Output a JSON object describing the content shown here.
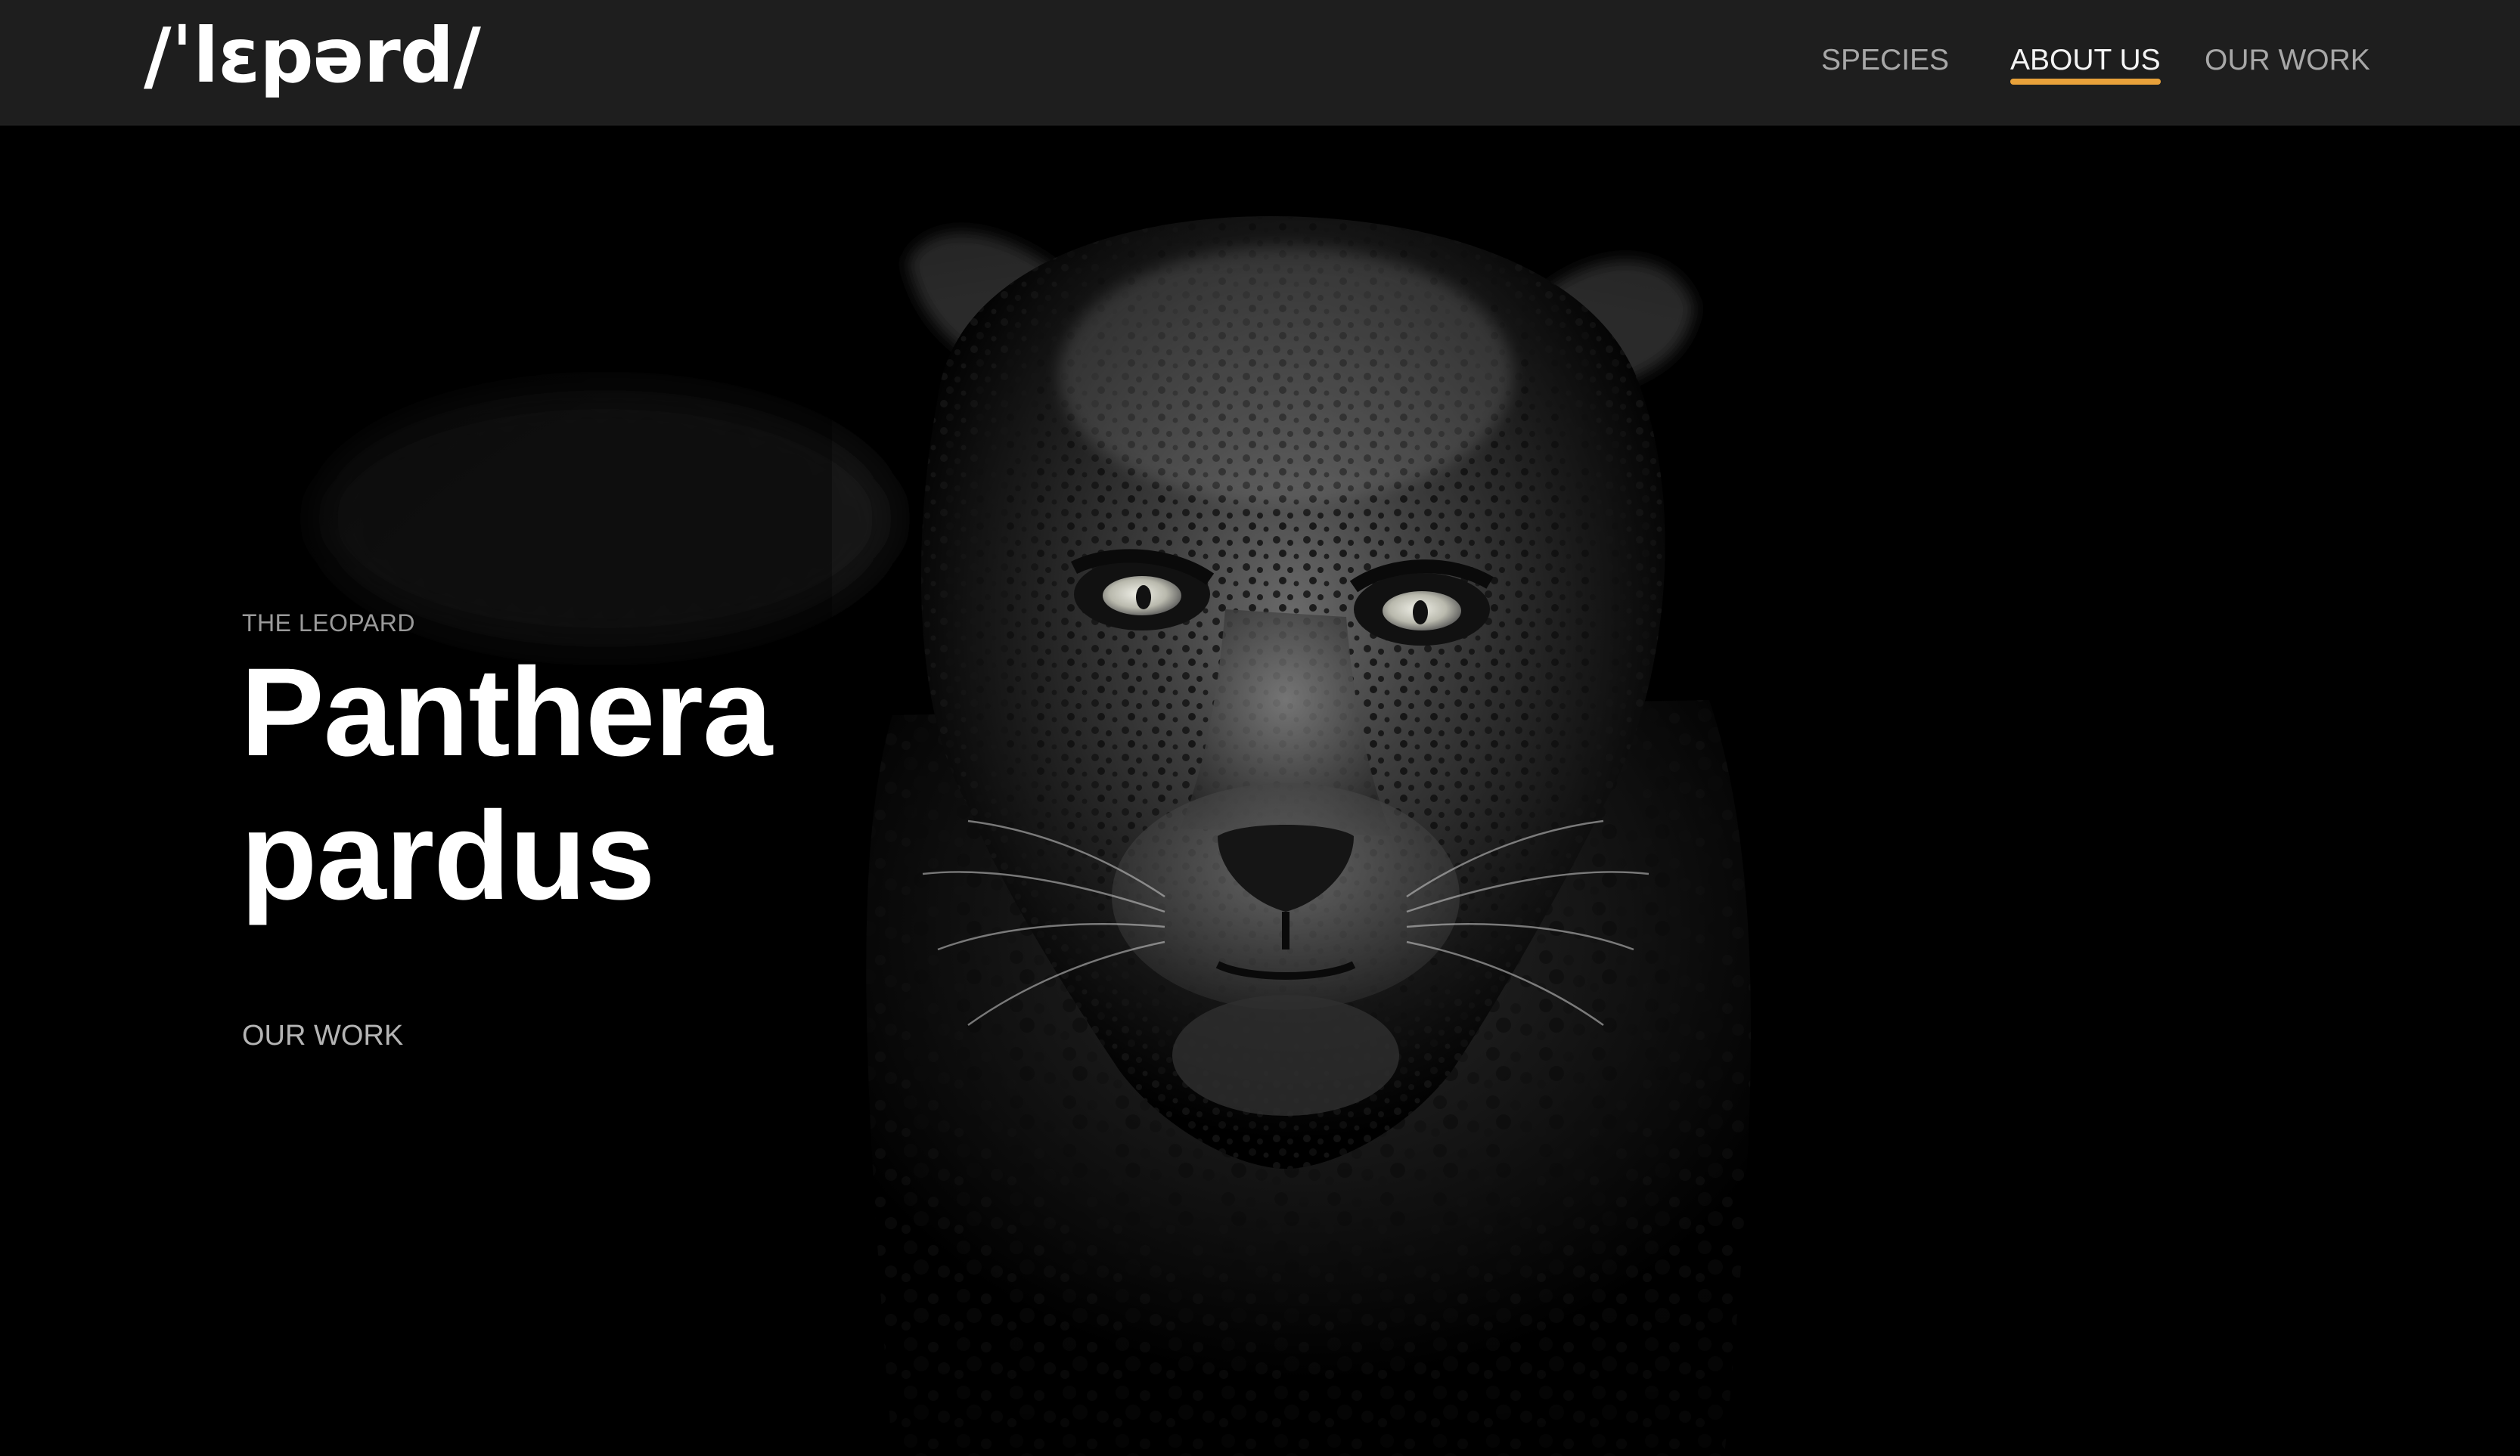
{
  "header": {
    "logo": "/ˈlɛpərd/",
    "nav": [
      {
        "label": "SPECIES",
        "active": false
      },
      {
        "label": "ABOUT US",
        "active": true
      },
      {
        "label": "OUR WORK",
        "active": false
      }
    ]
  },
  "hero": {
    "eyebrow": "THE LEOPARD",
    "title_line1": "Panthera",
    "title_line2": "pardus",
    "cta": "OUR WORK",
    "image": "leopard-face-photo"
  },
  "colors": {
    "header_bg": "#1e1e1e",
    "page_bg": "#000000",
    "accent": "#e8a13a",
    "nav_text": "#a8a8a8",
    "nav_active_text": "#f4f4f4"
  }
}
